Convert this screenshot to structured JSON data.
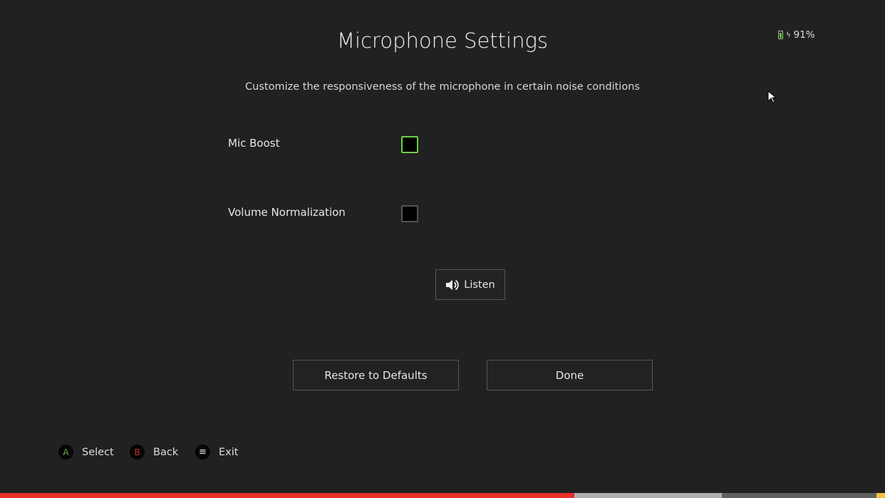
{
  "header": {
    "title": "Microphone Settings",
    "subtitle": "Customize the responsiveness of the microphone in certain noise conditions"
  },
  "status": {
    "battery": "91%",
    "battery_icon": "battery-charging-icon"
  },
  "options": [
    {
      "label": "Mic Boost",
      "checked": false,
      "focused": true
    },
    {
      "label": "Volume Normalization",
      "checked": false,
      "focused": false
    }
  ],
  "buttons": {
    "listen": "Listen",
    "restore": "Restore to Defaults",
    "done": "Done"
  },
  "hints": [
    {
      "key": "A",
      "label": "Select",
      "color": "#5fae46"
    },
    {
      "key": "B",
      "label": "Back",
      "color": "#c0302a"
    },
    {
      "key": "menu",
      "label": "Exit",
      "color": "#e6e6e6"
    }
  ],
  "progress": {
    "played_fraction": 0.649,
    "buffered_fraction": 0.816,
    "colors": {
      "played": "#e8302a",
      "buffered": "#b0b0b0",
      "remaining": "#606060",
      "marker": "#f0c040"
    }
  }
}
